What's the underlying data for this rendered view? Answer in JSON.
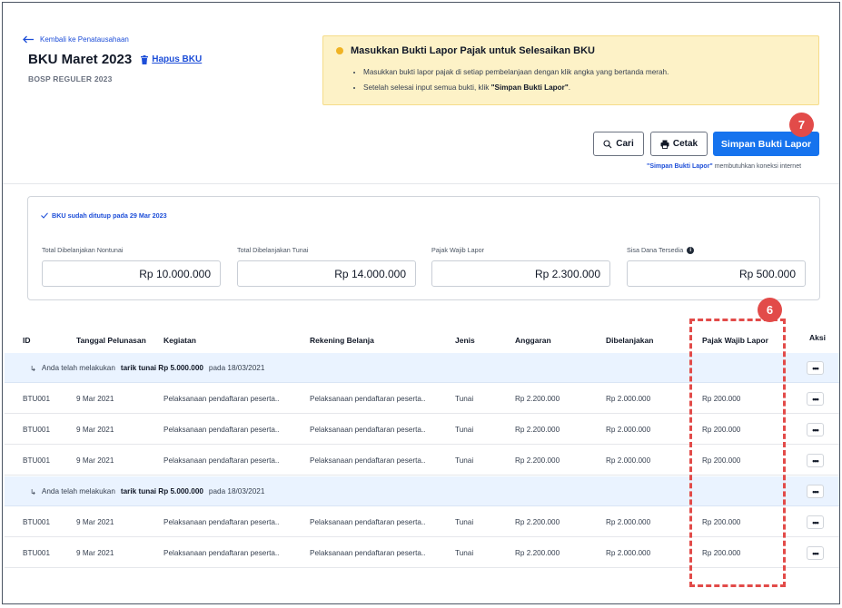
{
  "header": {
    "back_label": "Kembali ke Penatausahaan",
    "title": "BKU Maret 2023",
    "delete_label": "Hapus BKU",
    "subtitle": "BOSP REGULER 2023"
  },
  "notice": {
    "title": "Masukkan Bukti Lapor Pajak untuk Selesaikan BKU",
    "line1": "Masukkan bukti lapor pajak di setiap pembelanjaan dengan klik angka yang bertanda merah.",
    "line2_prefix": "Setelah selesai input semua bukti, klik ",
    "line2_bold": "\"Simpan Bukti Lapor\"",
    "line2_suffix": "."
  },
  "toolbar": {
    "search_label": "Cari",
    "print_label": "Cetak",
    "save_label": "Simpan Bukti Lapor",
    "hint_bold": "\"Simpan Bukti Lapor\"",
    "hint_rest": " membutuhkan koneksi internet"
  },
  "markers": {
    "badge_save": "7",
    "badge_column": "6"
  },
  "summary": {
    "closed_text": "BKU sudah ditutup pada 29 Mar 2023",
    "items": [
      {
        "label": "Total Dibelanjakan Nontunai",
        "value": "Rp 10.000.000"
      },
      {
        "label": "Total Dibelanjakan Tunai",
        "value": "Rp 14.000.000"
      },
      {
        "label": "Pajak Wajib Lapor",
        "value": "Rp 2.300.000"
      },
      {
        "label": "Sisa Dana Tersedia",
        "value": "Rp 500.000"
      }
    ]
  },
  "table": {
    "columns": [
      "ID",
      "Tanggal Pelunasan",
      "Kegiatan",
      "Rekening Belanja",
      "Jenis",
      "Anggaran",
      "Dibelanjakan",
      "Pajak Wajib Lapor",
      "Aksi"
    ],
    "info_row": {
      "prefix": "Anda telah melakukan",
      "bold": "tarik tunai Rp 5.000.000",
      "suffix": "pada 18/03/2021"
    },
    "more_label": "•••",
    "rows": [
      {
        "id": "BTU001",
        "tanggal": "9 Mar 2021",
        "kegiatan": "Pelaksanaan pendaftaran peserta..",
        "rekening": "Pelaksanaan pendaftaran peserta..",
        "jenis": "Tunai",
        "anggaran": "Rp 2.200.000",
        "dibelanjakan": "Rp 2.000.000",
        "pajak": "Rp 200.000"
      },
      {
        "id": "BTU001",
        "tanggal": "9 Mar 2021",
        "kegiatan": "Pelaksanaan pendaftaran peserta..",
        "rekening": "Pelaksanaan pendaftaran peserta..",
        "jenis": "Tunai",
        "anggaran": "Rp 2.200.000",
        "dibelanjakan": "Rp 2.000.000",
        "pajak": "Rp 200.000"
      },
      {
        "id": "BTU001",
        "tanggal": "9 Mar 2021",
        "kegiatan": "Pelaksanaan pendaftaran peserta..",
        "rekening": "Pelaksanaan pendaftaran peserta..",
        "jenis": "Tunai",
        "anggaran": "Rp 2.200.000",
        "dibelanjakan": "Rp 2.000.000",
        "pajak": "Rp 200.000"
      },
      {
        "id": "BTU001",
        "tanggal": "9 Mar 2021",
        "kegiatan": "Pelaksanaan pendaftaran peserta..",
        "rekening": "Pelaksanaan pendaftaran peserta..",
        "jenis": "Tunai",
        "anggaran": "Rp 2.200.000",
        "dibelanjakan": "Rp 2.000.000",
        "pajak": "Rp 200.000"
      },
      {
        "id": "BTU001",
        "tanggal": "9 Mar 2021",
        "kegiatan": "Pelaksanaan pendaftaran peserta..",
        "rekening": "Pelaksanaan pendaftaran peserta..",
        "jenis": "Tunai",
        "anggaran": "Rp 2.200.000",
        "dibelanjakan": "Rp 2.000.000",
        "pajak": "Rp 200.000"
      }
    ]
  },
  "colors": {
    "primary": "#1673ee",
    "highlight": "#e24b49",
    "notice_bg": "#fdf2c7",
    "info_row_bg": "#eaf3ff"
  }
}
